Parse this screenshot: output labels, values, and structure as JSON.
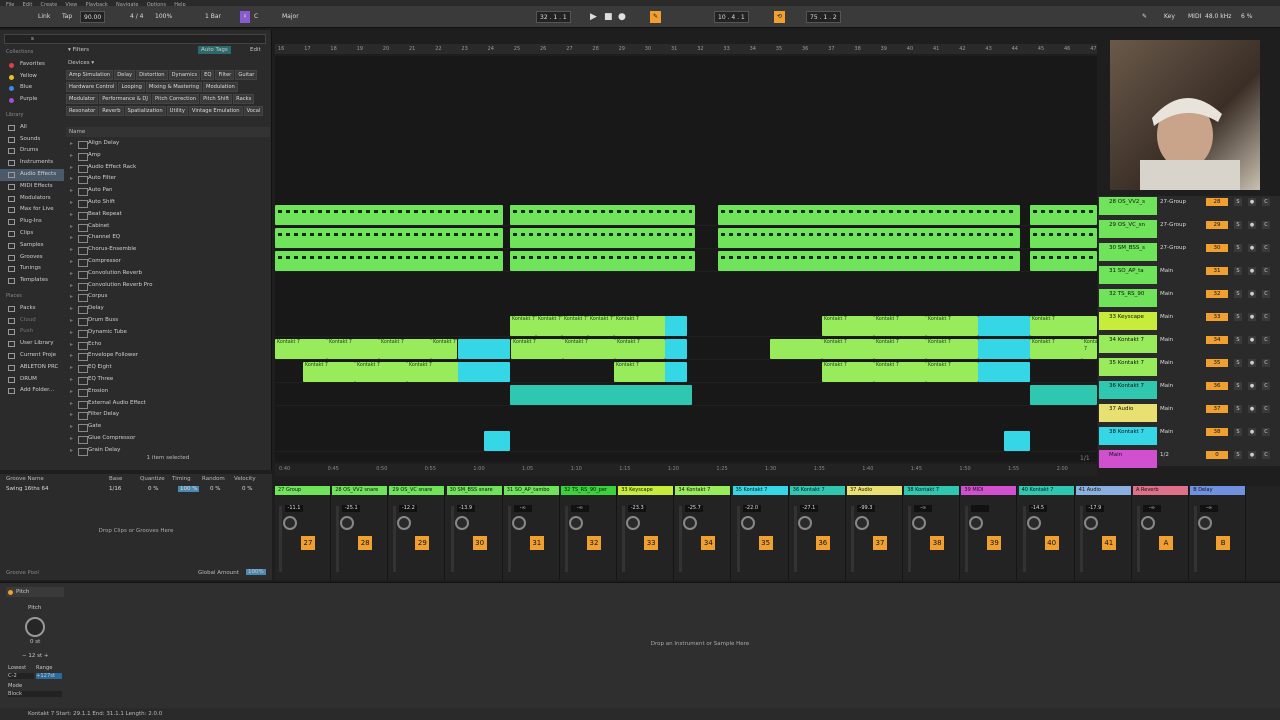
{
  "menu": [
    "File",
    "Edit",
    "Create",
    "View",
    "Playback",
    "Navigate",
    "Options",
    "Help"
  ],
  "toolbar": {
    "link": "Link",
    "tap": "Tap",
    "tempo": "90.00",
    "time_sig": "4 / 4",
    "zoom": "100%",
    "quantize": "1 Bar",
    "key": "C",
    "scale": "Major",
    "position": "32 .   1 .   1",
    "loop_start": "10 .   4 .   1",
    "loop_len": "75 .   1 .   2",
    "key_label": "Key",
    "midi_label": "MIDI",
    "sample_rate": "48.0 kHz",
    "cpu": "6 %"
  },
  "browser": {
    "search_placeholder": "s",
    "collections_header": "Collections",
    "collections": [
      {
        "label": "Favorites",
        "color": "#e04040"
      },
      {
        "label": "Yellow",
        "color": "#e8c020"
      },
      {
        "label": "Blue",
        "color": "#3a8ae0"
      },
      {
        "label": "Purple",
        "color": "#a050d0"
      }
    ],
    "library_header": "Library",
    "library": [
      "All",
      "Sounds",
      "Drums",
      "Instruments",
      "Audio Effects",
      "MIDI Effects",
      "Modulators",
      "Max for Live",
      "Plug-Ins",
      "Clips",
      "Samples",
      "Grooves",
      "Tunings",
      "Templates"
    ],
    "selected_library": "Audio Effects",
    "places_header": "Places",
    "places": [
      "Packs",
      "Cloud",
      "Push",
      "User Library",
      "Current Proje",
      "ABLETON PRC",
      "DRUM",
      "Add Folder..."
    ],
    "filters_label": "Filters",
    "auto_tags": "Auto Tags",
    "edit": "Edit",
    "devices_label": "Devices",
    "tags": [
      "Amp Simulation",
      "Delay",
      "Distortion",
      "Dynamics",
      "EQ",
      "Filter",
      "Guitar",
      "Hardware Control",
      "Looping",
      "Mixing & Mastering",
      "Modulation",
      "Modulator",
      "Performance & DJ",
      "Pitch Correction",
      "Pitch Shift",
      "Racks",
      "Resonator",
      "Reverb",
      "Spatialization",
      "Utility",
      "Vintage Emulation",
      "Vocal"
    ],
    "name_header": "Name",
    "items": [
      "Align Delay",
      "Amp",
      "Audio Effect Rack",
      "Auto Filter",
      "Auto Pan",
      "Auto Shift",
      "Beat Repeat",
      "Cabinet",
      "Channel EQ",
      "Chorus-Ensemble",
      "Compressor",
      "Convolution Reverb",
      "Convolution Reverb Pro",
      "Corpus",
      "Delay",
      "Drum Buss",
      "Dynamic Tube",
      "Echo",
      "Envelope Follower",
      "EQ Eight",
      "EQ Three",
      "Erosion",
      "External Audio Effect",
      "Filter Delay",
      "Gate",
      "Glue Compressor",
      "Grain Delay"
    ],
    "selection_info": "1 item selected"
  },
  "ruler": [
    "16",
    "17",
    "18",
    "19",
    "20",
    "21",
    "22",
    "23",
    "24",
    "25",
    "26",
    "27",
    "28",
    "29",
    "30",
    "31",
    "32",
    "33",
    "34",
    "35",
    "36",
    "37",
    "38",
    "39",
    "40",
    "41",
    "42",
    "43",
    "44",
    "45",
    "46",
    "47"
  ],
  "time_ruler": [
    "0:40",
    "0:45",
    "0:50",
    "0:55",
    "1:00",
    "1:05",
    "1:10",
    "1:15",
    "1:20",
    "1:25",
    "1:30",
    "1:35",
    "1:40",
    "1:45",
    "1:50",
    "1:55",
    "2:00"
  ],
  "clip_name": "Kontakt 7",
  "tracks": [
    {
      "name": "28 OS_VV2_s",
      "route": "27-Group",
      "vol": "28",
      "color": "#6fe35a"
    },
    {
      "name": "29 OS_VC_sn",
      "route": "27-Group",
      "vol": "29",
      "color": "#6fe35a"
    },
    {
      "name": "30 SM_BSS_s",
      "route": "27-Group",
      "vol": "30",
      "color": "#6fe35a"
    },
    {
      "name": "31 SO_AP_ta",
      "route": "Main",
      "vol": "31",
      "color": "#6fe35a"
    },
    {
      "name": "32 TS_RS_90",
      "route": "Main",
      "vol": "32",
      "color": "#6fe35a"
    },
    {
      "name": "33 Keyscape",
      "route": "Main",
      "vol": "33",
      "color": "#c8ec3a"
    },
    {
      "name": "34 Kontakt 7",
      "route": "Main",
      "vol": "34",
      "color": "#98ec5c"
    },
    {
      "name": "35 Kontakt 7",
      "route": "Main",
      "vol": "35",
      "color": "#98ec5c"
    },
    {
      "name": "36 Kontakt 7",
      "route": "Main",
      "vol": "36",
      "color": "#2fc7b0"
    },
    {
      "name": "37 Audio",
      "route": "Main",
      "vol": "37",
      "color": "#e8e070"
    },
    {
      "name": "38 Kontakt 7",
      "route": "Main",
      "vol": "38",
      "color": "#35d6e6"
    },
    {
      "name": "Main",
      "route": "1/2",
      "vol": "0",
      "color": "#d050d0"
    }
  ],
  "groove": {
    "headers": [
      "Groove Name",
      "Base",
      "Quantize",
      "Timing",
      "Random",
      "Velocity"
    ],
    "row": [
      "Swing 16ths 64",
      "1/16",
      "0 %",
      "100 %",
      "0 %",
      "0 %"
    ],
    "drop": "Drop Clips or Grooves Here",
    "pool": "Groove Pool",
    "global_label": "Global Amount",
    "global_val": "100%"
  },
  "mixer": [
    {
      "name": "27 Group",
      "num": "27",
      "val": "-11.1",
      "color": "#6fe35a"
    },
    {
      "name": "28 OS_VV2 snare",
      "num": "28",
      "val": "-25.1",
      "color": "#6fe35a"
    },
    {
      "name": "29 OS_VC snare",
      "num": "29",
      "val": "-12.2",
      "color": "#6fe35a"
    },
    {
      "name": "30 SM_BSS snare",
      "num": "30",
      "val": "-13.9",
      "color": "#6fe35a"
    },
    {
      "name": "31 SO_AP_tambo",
      "num": "31",
      "val": "-∞",
      "color": "#6fe35a"
    },
    {
      "name": "32 TS_RS_90_per",
      "num": "32",
      "val": "-∞",
      "color": "#3ad23a"
    },
    {
      "name": "33 Keyscape",
      "num": "33",
      "val": "-23.3",
      "color": "#c8ec3a"
    },
    {
      "name": "34 Kontakt 7",
      "num": "34",
      "val": "-25.7",
      "color": "#98ec5c"
    },
    {
      "name": "35 Kontakt 7",
      "num": "35",
      "val": "-22.0",
      "color": "#35d6e6"
    },
    {
      "name": "36 Kontakt 7",
      "num": "36",
      "val": "-27.1",
      "color": "#2fc7b0"
    },
    {
      "name": "37 Audio",
      "num": "37",
      "val": "-99.3",
      "color": "#e8e070"
    },
    {
      "name": "38 Kontakt 7",
      "num": "38",
      "val": "-∞",
      "color": "#2fc7b0"
    },
    {
      "name": "39 MIDI",
      "num": "39",
      "val": "",
      "color": "#d050d0"
    },
    {
      "name": "40 Kontakt 7",
      "num": "40",
      "val": "-14.5",
      "color": "#2fc7b0"
    },
    {
      "name": "41 Audio",
      "num": "41",
      "val": "-17.9",
      "color": "#8ab0e0"
    },
    {
      "name": "A Reverb",
      "num": "A",
      "val": "-∞",
      "color": "#e0708a"
    },
    {
      "name": "B Delay",
      "num": "B",
      "val": "-∞",
      "color": "#7090e0"
    }
  ],
  "device": {
    "name": "Pitch",
    "param": "Pitch",
    "value": "0 st",
    "range": "12 st",
    "lowest_label": "Lowest",
    "range_label": "Range",
    "lowest_val": "C-2",
    "range_val": "+127st",
    "mode_label": "Mode",
    "mode_val": "Block",
    "drop": "Drop an Instrument or Sample Here"
  },
  "status": "Kontakt 7  Start: 29.1.1  End: 31.1.1  Length: 2.0.0",
  "page": "1/1"
}
